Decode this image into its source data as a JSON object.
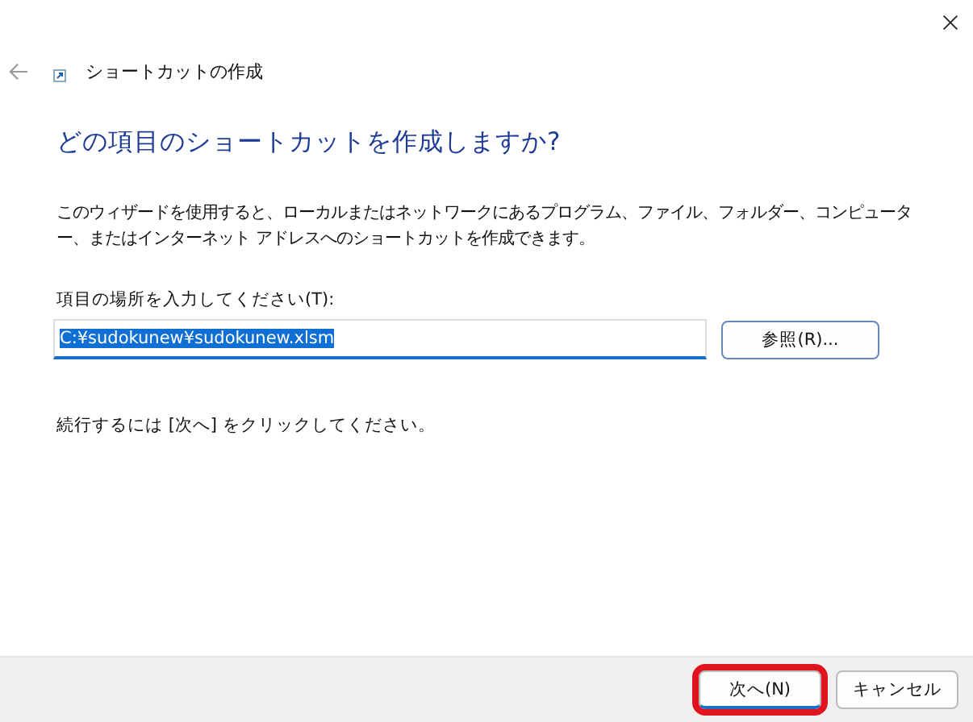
{
  "window": {
    "title": "ショートカットの作成"
  },
  "heading": "どの項目のショートカットを作成しますか?",
  "description": "このウィザードを使用すると、ローカルまたはネットワークにあるプログラム、ファイル、フォルダー、コンピューター、またはインターネット アドレスへのショートカットを作成できます。",
  "location": {
    "label": "項目の場所を入力してください(T):",
    "value": "C:¥sudokunew¥sudokunew.xlsm",
    "value_selected": true
  },
  "browse_button": "参照(R)...",
  "instruction": "続行するには [次へ] をクリックしてください。",
  "buttons": [
    {
      "label": "次へ(N)",
      "default": true,
      "highlighted": true
    },
    {
      "label": "キャンセル",
      "default": false,
      "highlighted": false
    }
  ]
}
